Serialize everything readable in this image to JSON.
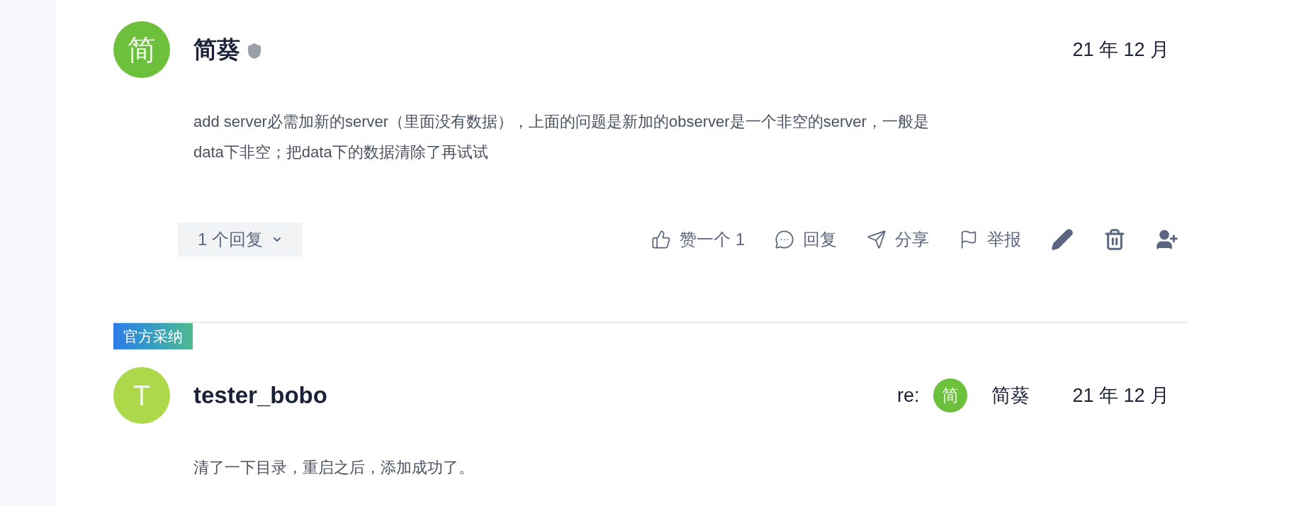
{
  "comments": [
    {
      "avatar": {
        "initial": "简",
        "color": "#6cc03c"
      },
      "author": "简葵",
      "verified": true,
      "date": "21 年 12 月",
      "body": "add server必需加新的server（里面没有数据），上面的问题是新加的observer是一个非空的server，一般是data下非空；把data下的数据清除了再试试",
      "replies_toggle": "1 个回复",
      "actions": [
        {
          "kind": "like",
          "label": "赞一个 1"
        },
        {
          "kind": "reply",
          "label": "回复"
        },
        {
          "kind": "share",
          "label": "分享"
        },
        {
          "kind": "report",
          "label": "举报"
        },
        {
          "kind": "edit"
        },
        {
          "kind": "delete"
        },
        {
          "kind": "follow"
        }
      ]
    },
    {
      "badge": "官方采纳",
      "avatar": {
        "initial": "T",
        "color": "#acd84a"
      },
      "author": "tester_bobo",
      "reply_to": {
        "prefix": "re:",
        "avatar": {
          "initial": "简",
          "color": "#6cc03c"
        },
        "name": "简葵"
      },
      "date": "21 年 12 月",
      "body": "清了一下目录，重启之后，添加成功了。"
    }
  ]
}
